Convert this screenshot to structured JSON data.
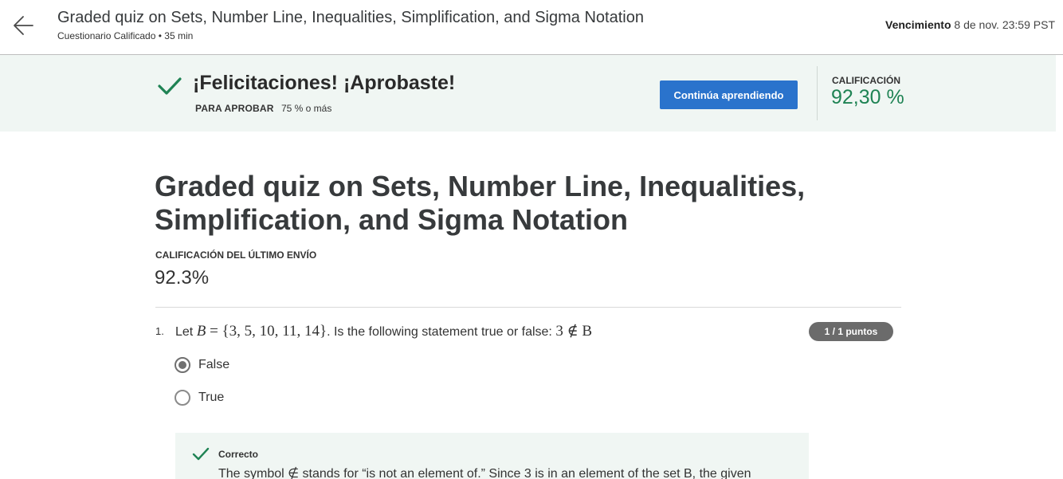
{
  "header": {
    "title": "Graded quiz on Sets, Number Line, Inequalities, Simplification, and Sigma Notation",
    "subtitle": "Cuestionario Calificado • 35 min",
    "due_label": "Vencimiento",
    "due_value": "8 de nov. 23:59 PST"
  },
  "banner": {
    "title": "¡Felicitaciones! ¡Aprobaste!",
    "pass_label": "PARA APROBAR",
    "pass_value": "75 % o más",
    "continue_button": "Continúa aprendiendo",
    "grade_label": "CALIFICACIÓN",
    "grade_value": "92,30 %"
  },
  "main": {
    "title": "Graded quiz on Sets, Number Line, Inequalities, Simplification, and Sigma Notation",
    "last_submission_label": "CALIFICACIÓN DEL ÚLTIMO ENVÍO",
    "last_submission_value": "92.3%"
  },
  "question": {
    "number": "1.",
    "text_prefix": "Let",
    "text_set_name": "B",
    "text_set": "= {3, 5, 10, 11, 14}",
    "text_middle": ". Is the following statement true or false:",
    "text_statement": "3 ∉ B",
    "points": "1 / 1 puntos",
    "options": [
      {
        "label": "False",
        "selected": true
      },
      {
        "label": "True",
        "selected": false
      }
    ]
  },
  "feedback": {
    "title": "Correcto",
    "text": "The symbol ∉ stands for “is not an element of.” Since 3 is in an element of the set B, the given"
  },
  "colors": {
    "accent_green": "#1f8354",
    "button_blue": "#2a73cc",
    "banner_bg": "#f0f6f3",
    "badge_gray": "#6b6b6b"
  },
  "icons": {
    "back": "arrow-left-icon",
    "banner_check": "check-icon",
    "feedback_check": "check-icon"
  }
}
